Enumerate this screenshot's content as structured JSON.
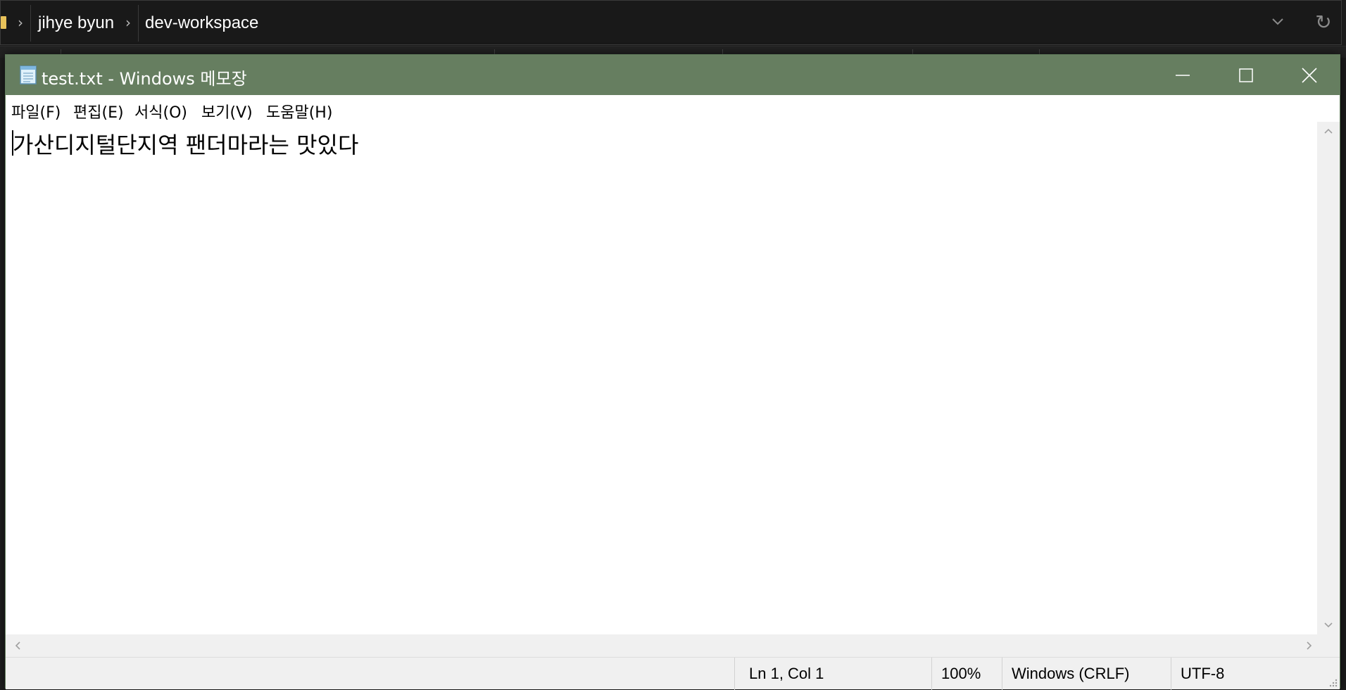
{
  "explorer": {
    "breadcrumbs": [
      "jihye byun",
      "dev-workspace"
    ],
    "icons": {
      "folder": "folder-icon",
      "separator": "chevron-right-icon",
      "dropdown": "chevron-down-icon",
      "refresh": "refresh-icon"
    }
  },
  "notepad": {
    "title": "test.txt - Windows 메모장",
    "app_icon": "notepad-icon",
    "title_color": "#667e60",
    "controls": {
      "minimize": "minimize-icon",
      "maximize": "maximize-icon",
      "close": "close-icon"
    },
    "menu": [
      "파일(F)",
      "편집(E)",
      "서식(O)",
      "보기(V)",
      "도움말(H)"
    ],
    "content": "가산디지털단지역 팬더마라는 맛있다",
    "status": {
      "position": "Ln 1, Col 1",
      "zoom": "100%",
      "line_ending": "Windows (CRLF)",
      "encoding": "UTF-8"
    }
  }
}
